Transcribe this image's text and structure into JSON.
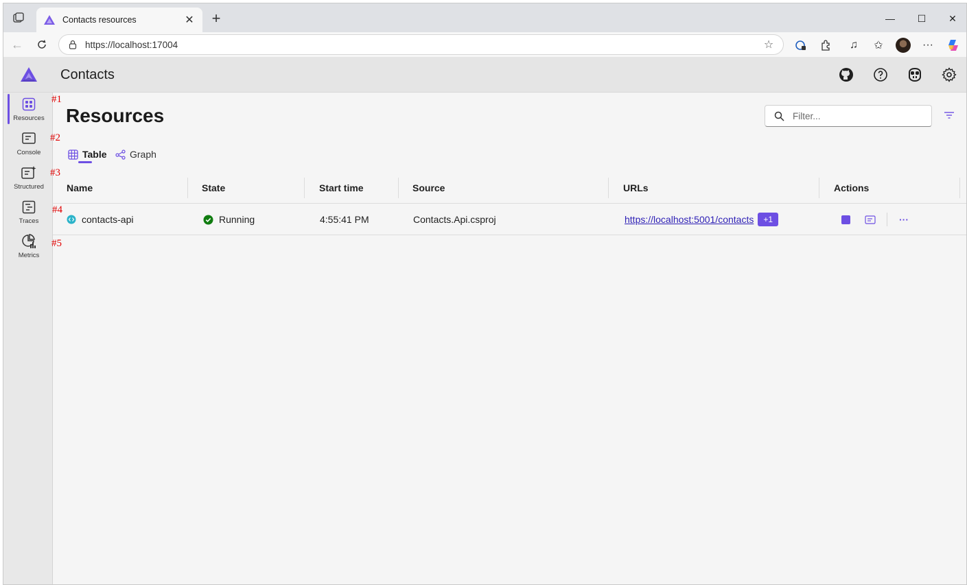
{
  "browser": {
    "tab_title": "Contacts resources",
    "url": "https://localhost:17004",
    "new_tab_label": "+",
    "window_controls": {
      "minimize": "—",
      "maximize": "☐",
      "close": "✕"
    },
    "toolbar_icons": [
      "password-manager-icon",
      "extensions-icon",
      "media-icon",
      "favorites-icon",
      "profile-avatar",
      "more-icon",
      "copilot-icon"
    ],
    "more_label": "···"
  },
  "app": {
    "title": "Contacts",
    "header_icons": [
      "github-icon",
      "help-icon",
      "copilot-icon",
      "settings-icon"
    ],
    "accent_color": "#6d4fe3"
  },
  "sidebar": {
    "items": [
      {
        "label": "Resources",
        "icon": "resources-icon",
        "active": true
      },
      {
        "label": "Console",
        "icon": "console-icon",
        "active": false
      },
      {
        "label": "Structured",
        "icon": "structured-logs-icon",
        "active": false
      },
      {
        "label": "Traces",
        "icon": "traces-icon",
        "active": false
      },
      {
        "label": "Metrics",
        "icon": "metrics-icon",
        "active": false
      }
    ]
  },
  "markers": [
    "#1",
    "#2",
    "#3",
    "#4",
    "#5"
  ],
  "page": {
    "title": "Resources",
    "filter_placeholder": "Filter...",
    "view_tabs": [
      {
        "label": "Table",
        "active": true
      },
      {
        "label": "Graph",
        "active": false
      }
    ]
  },
  "table": {
    "columns": [
      "Name",
      "State",
      "Start time",
      "Source",
      "URLs",
      "Actions"
    ],
    "rows": [
      {
        "name": "contacts-api",
        "state": "Running",
        "state_color": "#107c10",
        "start_time": "4:55:41 PM",
        "source": "Contacts.Api.csproj",
        "url": "https://localhost:5001/contacts",
        "url_extra": "+1",
        "actions": [
          "stop-icon",
          "console-logs-icon",
          "more-icon"
        ],
        "actions_more": "···"
      }
    ]
  }
}
